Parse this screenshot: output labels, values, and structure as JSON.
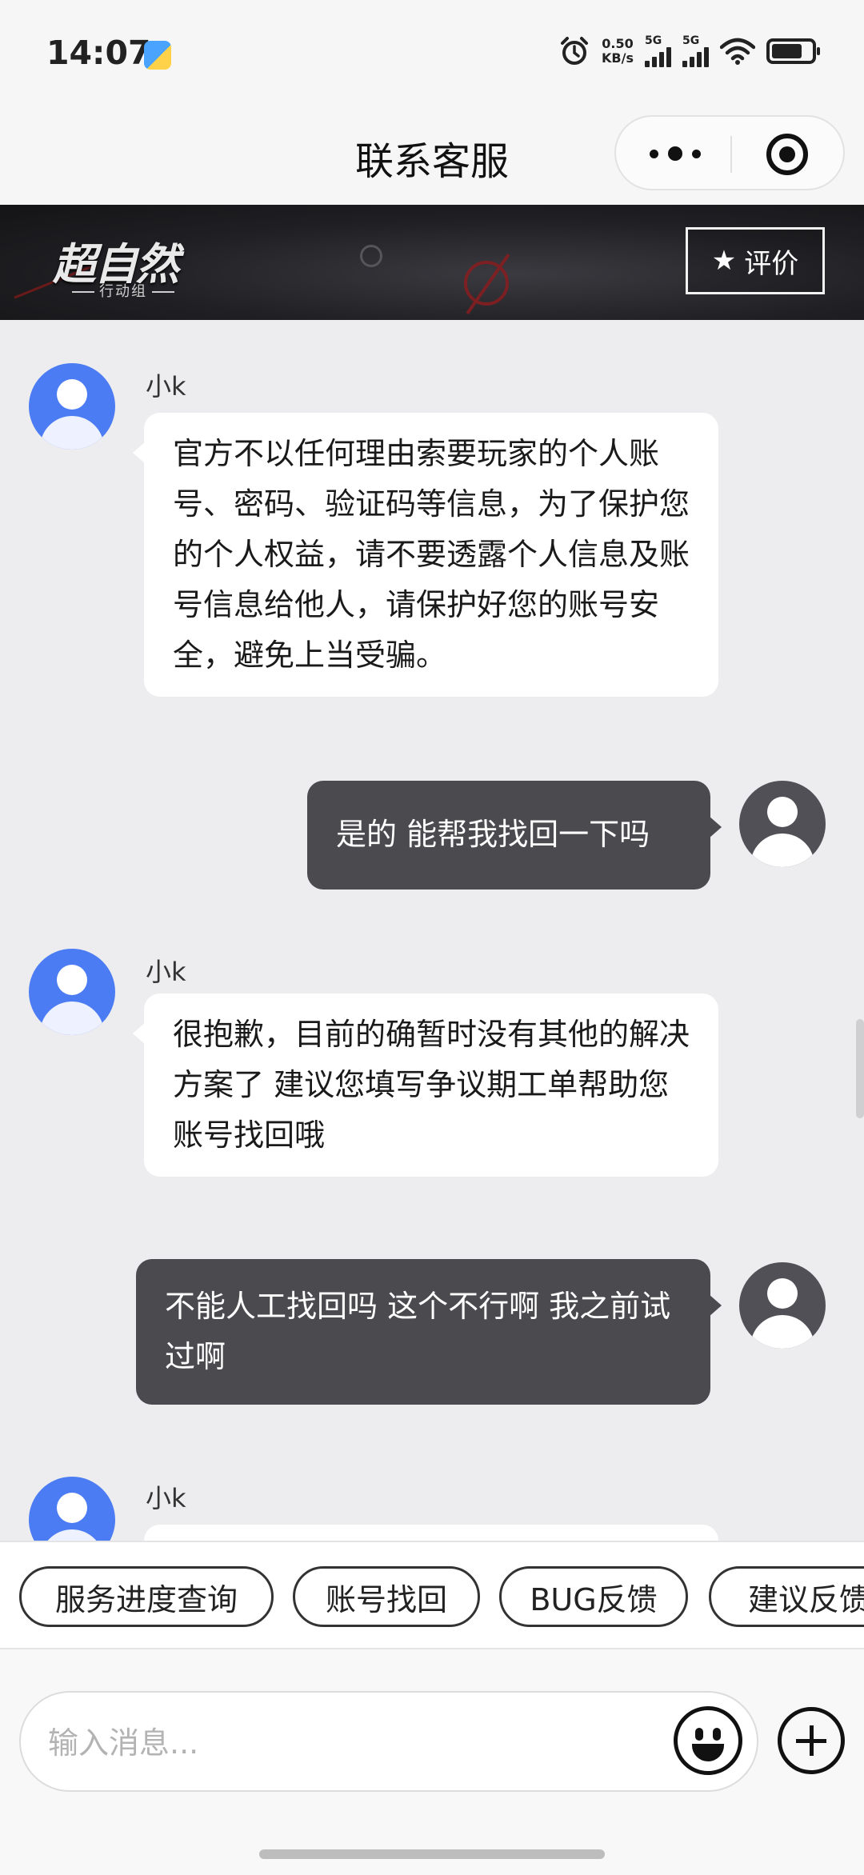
{
  "status_bar": {
    "time": "14:07",
    "net_speed_value": "0.50",
    "net_speed_unit": "KB/s",
    "sim1": "5G",
    "sim2": "5G"
  },
  "nav": {
    "title": "联系客服"
  },
  "banner": {
    "logo_text": "超自然",
    "logo_subtitle": "行动组",
    "rate_label": "评价"
  },
  "messages": [
    {
      "sender": "agent",
      "name": "小k",
      "text": "官方不以任何理由索要玩家的个人账号、密码、验证码等信息，为了保护您的个人权益，请不要透露个人信息及账号信息给他人，请保护好您的账号安全，避免上当受骗。"
    },
    {
      "sender": "user",
      "text": "是的 能帮我找回一下吗"
    },
    {
      "sender": "agent",
      "name": "小k",
      "text": "很抱歉，目前的确暂时没有其他的解决方案了 建议您填写争议期工单帮助您账号找回哦"
    },
    {
      "sender": "user",
      "text": "不能人工找回吗 这个不行啊 我之前试过啊"
    },
    {
      "sender": "agent",
      "name": "小k",
      "text": ""
    }
  ],
  "quick_replies": [
    "服务进度查询",
    "账号找回",
    "BUG反馈",
    "建议反馈"
  ],
  "input": {
    "placeholder": "输入消息..."
  },
  "colors": {
    "agent_avatar": "#4b7cf3",
    "user_bubble": "#4a4a4f",
    "background": "#ededef"
  }
}
